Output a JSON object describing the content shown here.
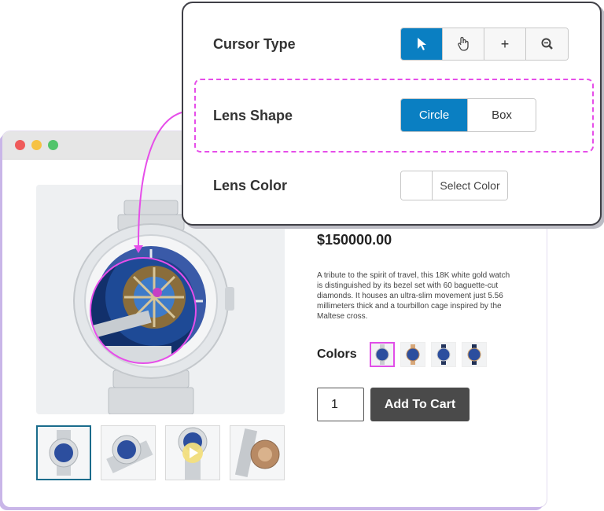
{
  "settings_panel": {
    "cursor_type_label": "Cursor Type",
    "cursor_options": [
      "pointer-arrow-icon",
      "hand-icon",
      "plus-icon",
      "zoom-icon"
    ],
    "cursor_selected": "pointer-arrow-icon",
    "plus_glyph": "+",
    "lens_shape_label": "Lens Shape",
    "lens_shape_options": [
      "Circle",
      "Box"
    ],
    "lens_shape_selected": "Circle",
    "lens_color_label": "Lens Color",
    "select_color_label": "Select Color"
  },
  "product": {
    "price": "$150000.00",
    "description": "A tribute to the spirit of travel, this 18K white gold watch is distinguished by its bezel set with 60 baguette-cut diamonds. It houses an ultra-slim movement just 5.56 millimeters thick and a tourbillon cage inspired by the Maltese cross.",
    "colors_label": "Colors",
    "quantity": "1",
    "add_to_cart_label": "Add To Cart"
  },
  "colors": {
    "accent": "#0a7fc2",
    "highlight": "#e64ee9",
    "dark_button": "#4a4a4a"
  }
}
